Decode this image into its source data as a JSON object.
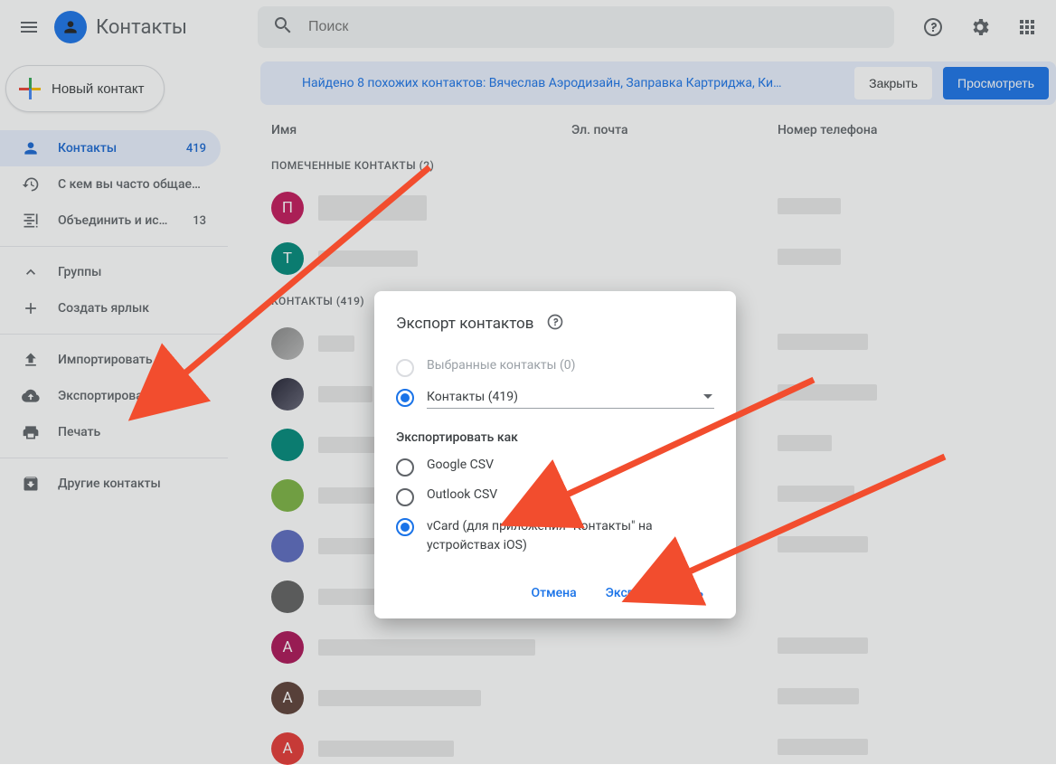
{
  "header": {
    "app_title": "Контакты",
    "search_placeholder": "Поиск"
  },
  "sidebar": {
    "new_contact_label": "Новый контакт",
    "items": [
      {
        "icon": "person",
        "label": "Контакты",
        "badge": "419",
        "active": true
      },
      {
        "icon": "history",
        "label": "С кем вы часто общае…",
        "badge": ""
      },
      {
        "icon": "merge",
        "label": "Объединить и испр…",
        "badge": "13"
      }
    ],
    "items2": [
      {
        "icon": "chevron",
        "label": "Группы"
      },
      {
        "icon": "plus",
        "label": "Создать ярлык"
      }
    ],
    "items3": [
      {
        "icon": "upload",
        "label": "Импортировать"
      },
      {
        "icon": "cloud",
        "label": "Экспортировать"
      },
      {
        "icon": "print",
        "label": "Печать"
      }
    ],
    "items4": [
      {
        "icon": "archive",
        "label": "Другие контакты"
      }
    ]
  },
  "banner": {
    "text": "Найдено 8 похожих контактов: Вячеслав Аэродизайн, Заправка Картриджа, Ки…",
    "close_label": "Закрыть",
    "view_label": "Просмотреть"
  },
  "columns": {
    "name": "Имя",
    "email": "Эл. почта",
    "phone": "Номер телефона"
  },
  "sections": {
    "starred": "ПОМЕЧЕННЫЕ КОНТАКТЫ (2)",
    "contacts": "КОНТАКТЫ (419)"
  },
  "dialog": {
    "title": "Экспорт контактов",
    "opt_selected": "Выбранные контакты (0)",
    "opt_group_value": "Контакты (419)",
    "export_as_label": "Экспортировать как",
    "fmt_google": "Google CSV",
    "fmt_outlook": "Outlook CSV",
    "fmt_vcard": "vCard (для приложения \"Контакты\" на устройствах iOS)",
    "cancel": "Отмена",
    "export": "Экспортировать"
  },
  "colors": {
    "accent": "#1a73e8"
  },
  "starred_rows": [
    {
      "letter": "П",
      "bg": "#c2185b"
    },
    {
      "letter": "Т",
      "bg": "#00897b"
    }
  ],
  "contact_rows": [
    {
      "letter": "",
      "bg": "url"
    },
    {
      "letter": "",
      "bg": "url"
    },
    {
      "letter": "",
      "bg": "#00897b"
    },
    {
      "letter": "",
      "bg": "#7cb342"
    },
    {
      "letter": "",
      "bg": "#5c6bc0"
    },
    {
      "letter": "",
      "bg": "#616161"
    },
    {
      "letter": "А",
      "bg": "#ad1457"
    },
    {
      "letter": "А",
      "bg": "#5d4037"
    },
    {
      "letter": "А",
      "bg": "#e53935"
    }
  ]
}
